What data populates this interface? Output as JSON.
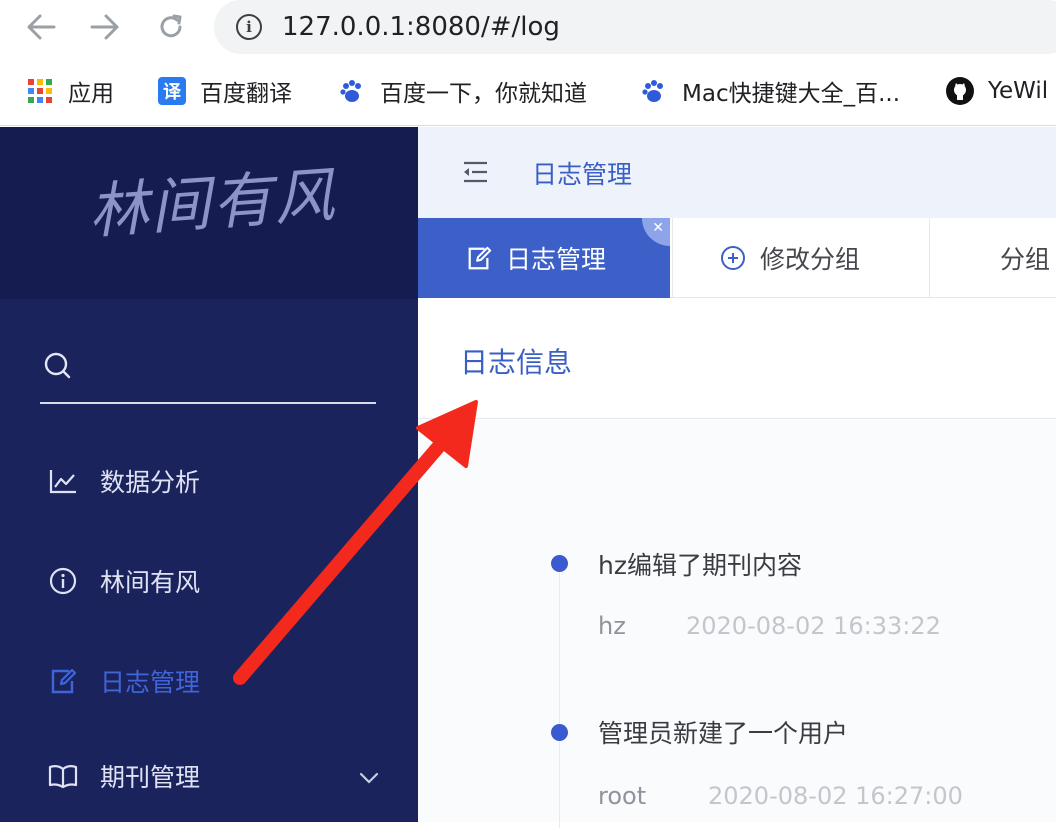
{
  "browser": {
    "url": "127.0.0.1:8080/#/log",
    "bookmarks": [
      {
        "label": "应用",
        "icon": "apps-grid-icon"
      },
      {
        "label": "百度翻译",
        "icon": "translate-icon",
        "icon_glyph": "译"
      },
      {
        "label": "百度一下，你就知道",
        "icon": "baidu-paw-icon"
      },
      {
        "label": "Mac快捷键大全_百...",
        "icon": "baidu-paw-icon"
      },
      {
        "label": "YeWil",
        "icon": "github-icon"
      }
    ]
  },
  "sidebar": {
    "logo": "林间有风",
    "search_placeholder": "",
    "items": [
      {
        "label": "数据分析",
        "icon": "line-chart-icon",
        "active": false
      },
      {
        "label": "林间有风",
        "icon": "info-circle-icon",
        "active": false
      },
      {
        "label": "日志管理",
        "icon": "edit-icon",
        "active": true
      },
      {
        "label": "期刊管理",
        "icon": "book-icon",
        "active": false,
        "has_submenu": true
      }
    ]
  },
  "header": {
    "title": "日志管理"
  },
  "tabs": [
    {
      "label": "日志管理",
      "icon": "edit-icon",
      "active": true
    },
    {
      "label": "修改分组",
      "icon": "plus-circle-icon",
      "active": false
    },
    {
      "label": "分组",
      "icon": "",
      "active": false
    }
  ],
  "panel": {
    "title": "日志信息"
  },
  "logs": [
    {
      "message": "hz编辑了期刊内容",
      "user": "hz",
      "time": "2020-08-02 16:33:22"
    },
    {
      "message": "管理员新建了一个用户",
      "user": "root",
      "time": "2020-08-02 16:27:00"
    }
  ],
  "colors": {
    "sidebar_bg": "#1b235d",
    "logo_bg": "#151c4f",
    "accent": "#3c5fc8",
    "timeline_dot": "#3a5bd0",
    "annotation_arrow": "#f2291c"
  }
}
